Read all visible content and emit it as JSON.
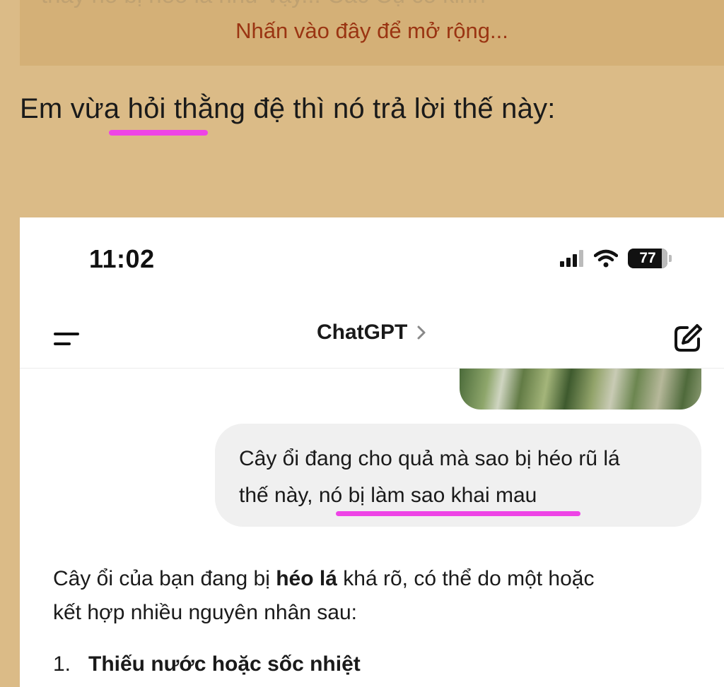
{
  "quote": {
    "faded_text": "thấy nó bị héo là như vậy... Các Cụ có kinh",
    "expand_link": "Nhấn vào đây để mở rộng..."
  },
  "post": {
    "text": "Em vừa hỏi thằng đệ thì nó trả lời thế này:"
  },
  "colors": {
    "background": "#dbbb87",
    "quote_background": "#d4b077",
    "link": "#9a3412",
    "highlight_mark": "#ee44e6"
  },
  "screenshot": {
    "status_bar": {
      "time": "11:02",
      "battery": "77",
      "icons": [
        "signal-icon",
        "wifi-icon",
        "battery-icon"
      ]
    },
    "nav": {
      "title": "ChatGPT",
      "icons": [
        "menu-icon",
        "chevron-right-icon",
        "edit-icon"
      ]
    },
    "user_message": {
      "line1": "Cây ổi đang cho quả mà sao bị héo rũ lá",
      "line2_start": "thế này, ",
      "line2_highlight": "nó bị làm sao khai mau"
    },
    "reply": {
      "part1": "Cây ổi của bạn đang bị ",
      "bold": "héo lá",
      "part2": " khá rõ, có thể do một hoặc",
      "line2": "kết hợp nhiều nguyên nhân sau:"
    },
    "list": [
      {
        "number": "1.",
        "text": "Thiếu nước hoặc sốc nhiệt"
      }
    ]
  }
}
